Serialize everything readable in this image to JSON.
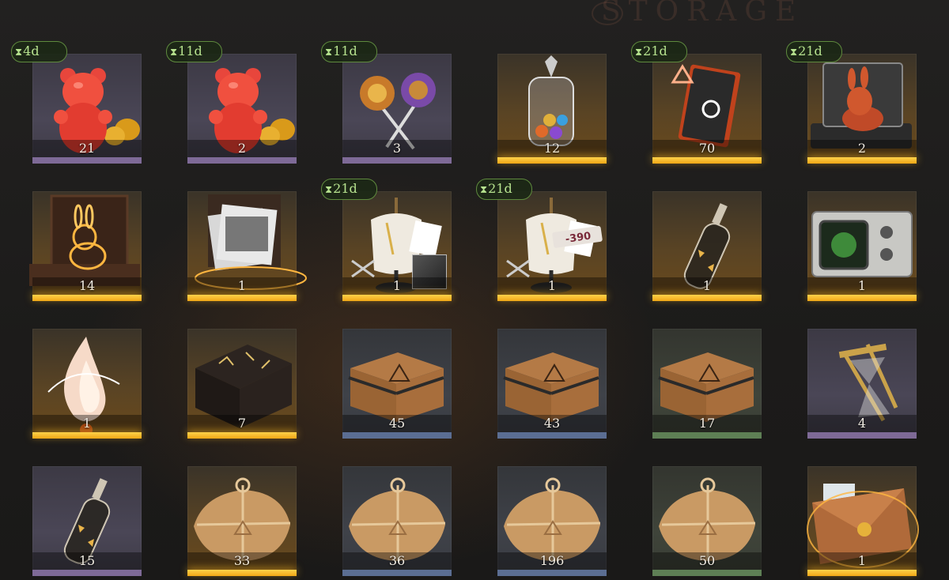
{
  "header": {
    "watermark": "STORAGE"
  },
  "timers": {
    "hourglass": "⧗"
  },
  "items": [
    {
      "name": "red-gummy-bear",
      "qty": "21",
      "timer": "4d",
      "rarity": "purple",
      "icon": "gummy-bear-icon"
    },
    {
      "name": "red-gummy-bear",
      "qty": "2",
      "timer": "11d",
      "rarity": "purple",
      "icon": "gummy-bear-icon"
    },
    {
      "name": "lollipops",
      "qty": "3",
      "timer": "11d",
      "rarity": "purple",
      "icon": "lollipop-icon"
    },
    {
      "name": "candy-jar",
      "qty": "12",
      "timer": "",
      "rarity": "gold",
      "icon": "jar-icon"
    },
    {
      "name": "rune-notebook",
      "qty": "70",
      "timer": "21d",
      "rarity": "gold",
      "icon": "notebook-icon"
    },
    {
      "name": "rabbit-case",
      "qty": "2",
      "timer": "21d",
      "rarity": "gold",
      "icon": "briefcase-icon"
    },
    {
      "name": "golden-rabbit-box",
      "qty": "14",
      "timer": "",
      "rarity": "gold",
      "icon": "rabbit-box-icon"
    },
    {
      "name": "photo-box",
      "qty": "1",
      "timer": "",
      "rarity": "gold",
      "icon": "photo-box-icon"
    },
    {
      "name": "tailor-mannequin",
      "qty": "1",
      "timer": "21d",
      "rarity": "gold",
      "icon": "mannequin-icon"
    },
    {
      "name": "tailor-mannequin-coupon",
      "qty": "1",
      "timer": "21d",
      "rarity": "gold",
      "icon": "mannequin-icon",
      "badge": "-390"
    },
    {
      "name": "message-bottle",
      "qty": "1",
      "timer": "",
      "rarity": "gold",
      "icon": "bottle-icon"
    },
    {
      "name": "radar-device",
      "qty": "1",
      "timer": "",
      "rarity": "gold",
      "icon": "radar-icon"
    },
    {
      "name": "glowing-flame",
      "qty": "1",
      "timer": "",
      "rarity": "gold",
      "icon": "flame-icon"
    },
    {
      "name": "rune-stool",
      "qty": "7",
      "timer": "",
      "rarity": "gold",
      "icon": "stool-icon"
    },
    {
      "name": "wooden-crate",
      "qty": "45",
      "timer": "",
      "rarity": "blue",
      "icon": "crate-icon"
    },
    {
      "name": "wooden-crate",
      "qty": "43",
      "timer": "",
      "rarity": "blue",
      "icon": "crate-icon"
    },
    {
      "name": "wooden-crate",
      "qty": "17",
      "timer": "",
      "rarity": "green",
      "icon": "crate-icon"
    },
    {
      "name": "hourglass",
      "qty": "4",
      "timer": "",
      "rarity": "purple",
      "icon": "hourglass-icon"
    },
    {
      "name": "message-bottle",
      "qty": "15",
      "timer": "",
      "rarity": "purple",
      "icon": "bottle-icon"
    },
    {
      "name": "paper-parcel",
      "qty": "33",
      "timer": "",
      "rarity": "gold",
      "icon": "parcel-icon"
    },
    {
      "name": "paper-parcel",
      "qty": "36",
      "timer": "",
      "rarity": "blue",
      "icon": "parcel-icon"
    },
    {
      "name": "paper-parcel",
      "qty": "196",
      "timer": "",
      "rarity": "blue",
      "icon": "parcel-icon"
    },
    {
      "name": "paper-parcel",
      "qty": "50",
      "timer": "",
      "rarity": "green",
      "icon": "parcel-icon"
    },
    {
      "name": "sealed-envelope",
      "qty": "1",
      "timer": "",
      "rarity": "gold",
      "icon": "envelope-icon"
    }
  ]
}
